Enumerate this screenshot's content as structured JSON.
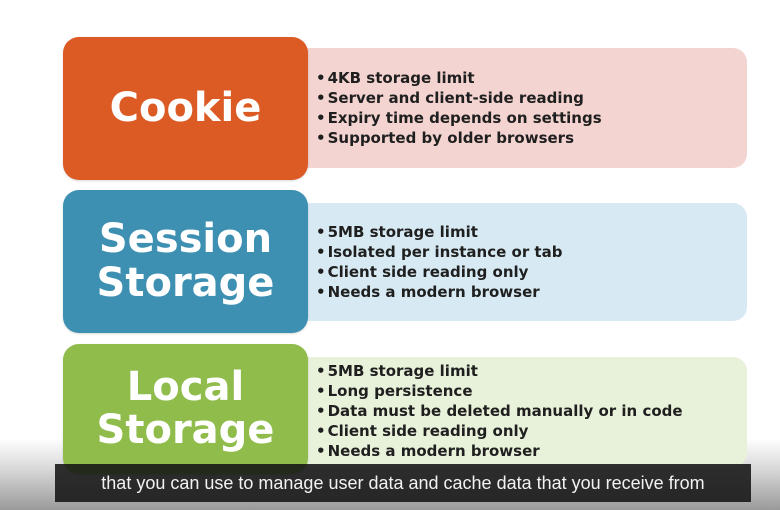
{
  "slide": {
    "cookie": {
      "title_lines": [
        "Cookie"
      ],
      "bullets": [
        "4KB storage limit",
        "Server and client-side reading",
        "Expiry time depends on settings",
        "Supported by older browsers"
      ]
    },
    "session": {
      "title_lines": [
        "Session",
        "Storage"
      ],
      "bullets": [
        "5MB storage limit",
        "Isolated per instance or tab",
        "Client side reading only",
        "Needs a modern browser"
      ]
    },
    "local": {
      "title_lines": [
        "Local",
        "Storage"
      ],
      "bullets": [
        "5MB storage limit",
        "Long persistence",
        "Data must be deleted manually or in code",
        "Client side reading only",
        "Needs a modern browser"
      ]
    }
  },
  "caption": {
    "text": "that you can use to manage user data and cache data that you receive from"
  },
  "colors": {
    "cookie_tile": "#dc5a24",
    "cookie_panel": "#f4d4d1",
    "session_tile": "#3d90b2",
    "session_panel": "#d7eaf3",
    "local_tile": "#8fbc4b",
    "local_panel": "#e8f1da",
    "bullet_marker": "•"
  }
}
